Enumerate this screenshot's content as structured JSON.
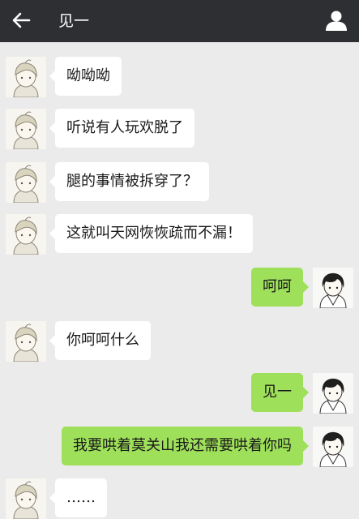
{
  "header": {
    "title": "见一",
    "back_icon": "back-arrow-icon",
    "profile_icon": "person-icon"
  },
  "colors": {
    "header_bg": "#2d2f33",
    "chat_bg": "#ebebeb",
    "incoming_bubble": "#ffffff",
    "outgoing_bubble": "#9ee05a"
  },
  "messages": [
    {
      "side": "left",
      "text": "呦呦呦"
    },
    {
      "side": "left",
      "text": "听说有人玩欢脱了"
    },
    {
      "side": "left",
      "text": "腿的事情被拆穿了？"
    },
    {
      "side": "left",
      "text": "这就叫天网恢恢疏而不漏！"
    },
    {
      "side": "right",
      "text": "呵呵"
    },
    {
      "side": "left",
      "text": "你呵呵什么"
    },
    {
      "side": "right",
      "text": "见一"
    },
    {
      "side": "right",
      "text": "我要哄着莫关山我还需要哄着你吗"
    },
    {
      "side": "left",
      "text": "……"
    }
  ]
}
